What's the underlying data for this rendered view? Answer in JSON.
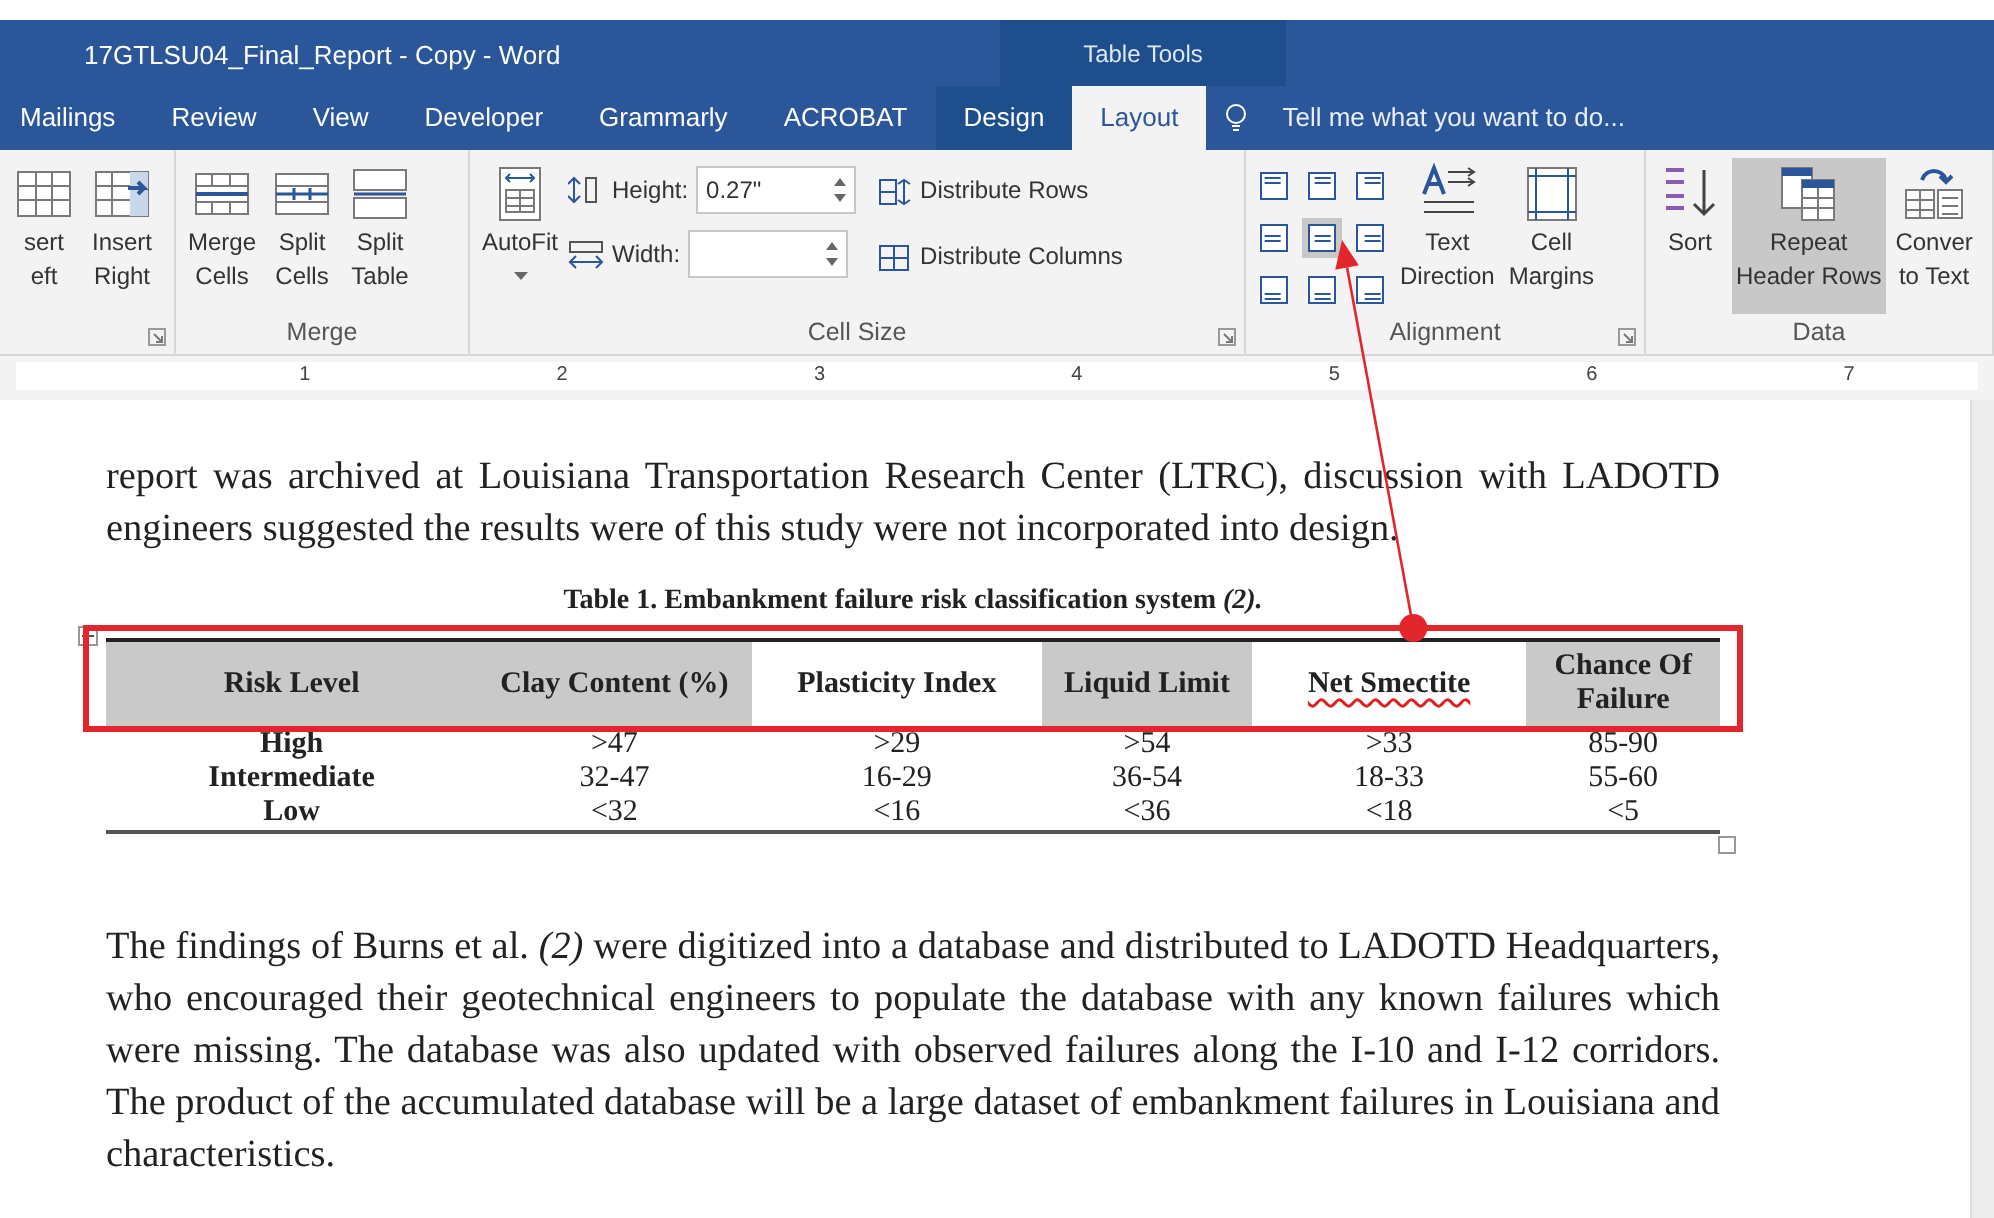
{
  "window": {
    "title": "17GTLSU04_Final_Report - Copy - Word",
    "context_label": "Table Tools"
  },
  "tabs": [
    {
      "label": "Mailings",
      "selected": false,
      "contextual": false
    },
    {
      "label": "Review",
      "selected": false,
      "contextual": false
    },
    {
      "label": "View",
      "selected": false,
      "contextual": false
    },
    {
      "label": "Developer",
      "selected": false,
      "contextual": false
    },
    {
      "label": "Grammarly",
      "selected": false,
      "contextual": false
    },
    {
      "label": "ACROBAT",
      "selected": false,
      "contextual": false
    },
    {
      "label": "Design",
      "selected": false,
      "contextual": true
    },
    {
      "label": "Layout",
      "selected": true,
      "contextual": true
    }
  ],
  "tell_me": {
    "placeholder": "Tell me what you want to do..."
  },
  "ribbon": {
    "groups": [
      {
        "kind": "buttons",
        "launcher": true,
        "buttons": [
          {
            "lines": [
              "sert",
              "eft"
            ],
            "selected": false
          },
          {
            "lines": [
              "Insert",
              "Right"
            ],
            "selected": false
          }
        ]
      },
      {
        "kind": "buttons",
        "label": "Merge",
        "launcher": false,
        "buttons": [
          {
            "lines": [
              "Merge",
              "Cells"
            ],
            "selected": false
          },
          {
            "lines": [
              "Split",
              "Cells"
            ],
            "selected": false
          },
          {
            "lines": [
              "Split",
              "Table"
            ],
            "selected": false
          }
        ]
      },
      {
        "kind": "cellsize",
        "label": "Cell Size",
        "launcher": true,
        "autofit": "AutoFit",
        "height_label": "Height:",
        "height_value": "0.27\"",
        "width_label": "Width:",
        "distribute": [
          "Distribute Rows",
          "Distribute Columns"
        ]
      },
      {
        "kind": "alignment",
        "label": "Alignment",
        "launcher": true,
        "align": [
          {
            "selected": false
          },
          {
            "selected": false
          },
          {
            "selected": false
          },
          {
            "selected": false
          },
          {
            "selected": true
          },
          {
            "selected": false
          },
          {
            "selected": false
          },
          {
            "selected": false
          },
          {
            "selected": false
          }
        ],
        "buttons": [
          {
            "lines": [
              "Text",
              "Direction"
            ],
            "selected": false
          },
          {
            "lines": [
              "Cell",
              "Margins"
            ],
            "selected": false
          }
        ]
      },
      {
        "kind": "buttons",
        "label": "Data",
        "launcher": false,
        "buttons": [
          {
            "lines": [
              "Sort"
            ],
            "selected": false
          },
          {
            "lines": [
              "Repeat",
              "Header Rows"
            ],
            "selected": true
          },
          {
            "lines": [
              "Conver",
              "to Text"
            ],
            "selected": false
          }
        ]
      }
    ]
  },
  "ruler": {
    "numbers": [
      "1",
      "2",
      "3",
      "4",
      "5",
      "6",
      "7"
    ]
  },
  "document": {
    "paragraph_1": "report was archived at Louisiana Transportation Research Center (LTRC), discussion with LADOTD engineers suggested the results were of this study were not incorporated into design.",
    "caption": "Table 1. Embankment failure risk classification system *(2).*",
    "table": {
      "columns": [
        {
          "label": "Risk Level",
          "shaded": true,
          "spelling_error": false
        },
        {
          "label": "Clay Content (%)",
          "shaded": true,
          "spelling_error": false
        },
        {
          "label": "Plasticity Index",
          "shaded": false,
          "spelling_error": false
        },
        {
          "label": "Liquid Limit",
          "shaded": true,
          "spelling_error": false
        },
        {
          "label": "Net Smectite",
          "shaded": false,
          "spelling_error": true
        },
        {
          "label": "Chance Of Failure",
          "shaded": true,
          "spelling_error": false
        }
      ],
      "rows": [
        [
          "High",
          ">47",
          ">29",
          ">54",
          ">33",
          "85-90"
        ],
        [
          "Intermediate",
          "32-47",
          "16-29",
          "36-54",
          "18-33",
          "55-60"
        ],
        [
          "Low",
          "<32",
          "<16",
          "<36",
          "<18",
          "<5"
        ]
      ]
    },
    "paragraph_2": "The findings of Burns et al. *(2)* were digitized into a database and distributed to LADOTD Headquarters, who encouraged their geotechnical engineers to populate the database with any known failures which were missing. The database was also updated with observed failures along the I-10 and I-12 corridors. The product of the accumulated database will be a large dataset of embankment failures in Louisiana and characteristics."
  },
  "callout": {
    "highlight_box": true,
    "arrow": true
  }
}
